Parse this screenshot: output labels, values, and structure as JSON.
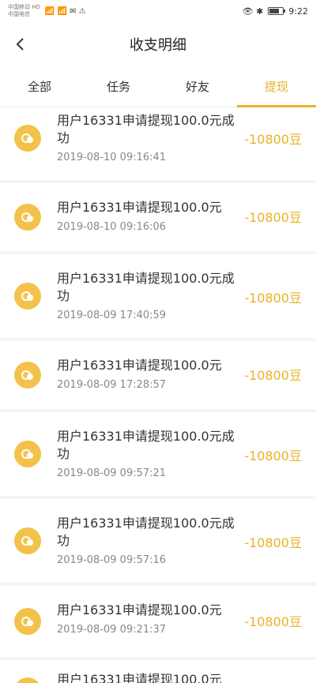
{
  "status": {
    "carrier1": "中国移动 HD",
    "carrier2": "中国电信",
    "indicators": "📶 📶 ✉ ⚠",
    "right_icons": "👁 ✱",
    "battery_label": "",
    "time": "9:22"
  },
  "nav": {
    "title": "收支明细"
  },
  "tabs": [
    {
      "label": "全部"
    },
    {
      "label": "任务"
    },
    {
      "label": "好友"
    },
    {
      "label": "提现",
      "active": true
    }
  ],
  "records": [
    {
      "desc": "用户16331申请提现100.0元成功",
      "time": "2019-08-10 09:16:41",
      "amount": "-10800豆"
    },
    {
      "desc": "用户16331申请提现100.0元",
      "time": "2019-08-10 09:16:06",
      "amount": "-10800豆"
    },
    {
      "desc": "用户16331申请提现100.0元成功",
      "time": "2019-08-09 17:40:59",
      "amount": "-10800豆"
    },
    {
      "desc": "用户16331申请提现100.0元",
      "time": "2019-08-09 17:28:57",
      "amount": "-10800豆"
    },
    {
      "desc": "用户16331申请提现100.0元成功",
      "time": "2019-08-09 09:57:21",
      "amount": "-10800豆"
    },
    {
      "desc": "用户16331申请提现100.0元成功",
      "time": "2019-08-09 09:57:16",
      "amount": "-10800豆"
    },
    {
      "desc": "用户16331申请提现100.0元",
      "time": "2019-08-09 09:21:37",
      "amount": "-10800豆"
    },
    {
      "desc": "用户16331申请提现100.0元",
      "time": "",
      "amount": ""
    }
  ],
  "colors": {
    "accent": "#e9b227",
    "coin": "#f2c24a"
  }
}
